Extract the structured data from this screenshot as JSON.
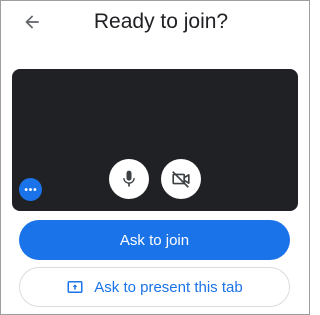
{
  "header": {
    "back_icon": "arrow-back-icon",
    "title": "Ready to join?"
  },
  "preview": {
    "more_icon": "more-horiz-icon",
    "mic_icon": "microphone-icon",
    "camera_icon": "camera-off-icon"
  },
  "actions": {
    "join_label": "Ask to join",
    "present_label": "Ask to present this tab",
    "present_icon": "present-to-all-icon"
  },
  "colors": {
    "accent": "#1a73e8",
    "preview_bg": "#202124",
    "text": "#202124",
    "border": "#dadce0"
  }
}
